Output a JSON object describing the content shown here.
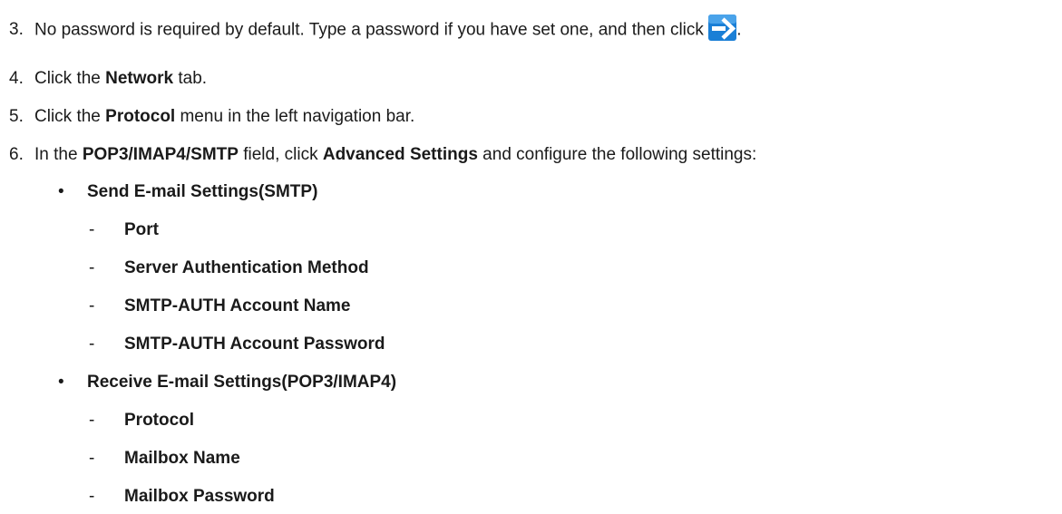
{
  "colors": {
    "text": "#1a1a1a",
    "go_icon_bg": "#1a7fd6",
    "go_icon_arrow": "#ffffff"
  },
  "steps": [
    {
      "number": "3.",
      "text_before": "No password is required by default. Type a password if you have set one, and then click",
      "icon": "arrow-right-icon",
      "text_after": "."
    },
    {
      "number": "4.",
      "text_before": "Click the ",
      "bold": "Network",
      "text_after": " tab."
    },
    {
      "number": "5.",
      "text_before": "Click the ",
      "bold": "Protocol",
      "text_after": " menu in the left navigation bar."
    },
    {
      "number": "6.",
      "text_before": "In the ",
      "bold": "POP3/IMAP4/SMTP",
      "text_middle": " field, click ",
      "bold2": "Advanced Settings",
      "text_after": " and configure the following settings:"
    }
  ],
  "bullet_mark": "•",
  "dash_mark": "-",
  "settings": [
    {
      "heading": "Send E-mail Settings(SMTP)",
      "items": [
        "Port",
        "Server Authentication Method",
        "SMTP-AUTH Account Name",
        "SMTP-AUTH Account Password"
      ]
    },
    {
      "heading": "Receive E-mail Settings(POP3/IMAP4)",
      "items": [
        "Protocol",
        "Mailbox Name",
        "Mailbox Password"
      ]
    }
  ]
}
